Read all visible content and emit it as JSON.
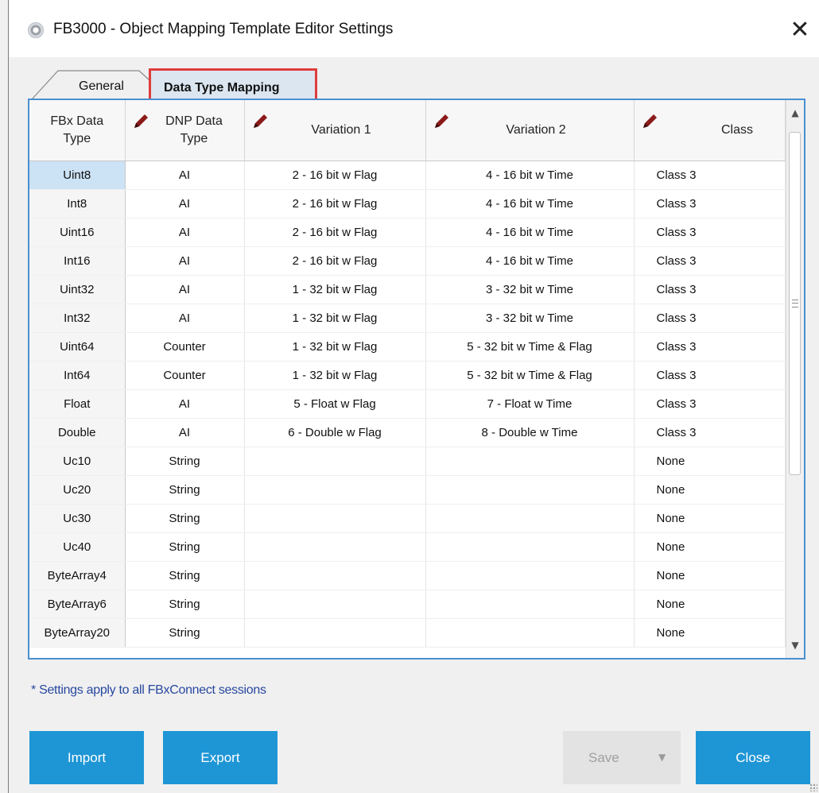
{
  "window": {
    "title": "FB3000 - Object Mapping Template Editor Settings",
    "close_glyph": "✕"
  },
  "tabs": [
    {
      "label": "General",
      "active": false
    },
    {
      "label": "Data Type Mapping",
      "active": true
    }
  ],
  "grid": {
    "columns": [
      {
        "label": "FBx Data\nType",
        "editable": false
      },
      {
        "label": "DNP Data\nType",
        "editable": true
      },
      {
        "label": "Variation 1",
        "editable": true
      },
      {
        "label": "Variation 2",
        "editable": true
      },
      {
        "label": "Class",
        "editable": true
      }
    ],
    "selected_row": 0,
    "rows": [
      [
        "Uint8",
        "AI",
        "2 - 16 bit w Flag",
        "4 - 16 bit w Time",
        "Class 3"
      ],
      [
        "Int8",
        "AI",
        "2 - 16 bit w Flag",
        "4 - 16 bit w Time",
        "Class 3"
      ],
      [
        "Uint16",
        "AI",
        "2 - 16 bit w Flag",
        "4 - 16 bit w Time",
        "Class 3"
      ],
      [
        "Int16",
        "AI",
        "2 - 16 bit w Flag",
        "4 - 16 bit w Time",
        "Class 3"
      ],
      [
        "Uint32",
        "AI",
        "1 - 32 bit w Flag",
        "3 - 32 bit w Time",
        "Class 3"
      ],
      [
        "Int32",
        "AI",
        "1 - 32 bit w Flag",
        "3 - 32 bit w Time",
        "Class 3"
      ],
      [
        "Uint64",
        "Counter",
        "1 - 32 bit w Flag",
        "5 - 32 bit w Time & Flag",
        "Class 3"
      ],
      [
        "Int64",
        "Counter",
        "1 - 32 bit w Flag",
        "5 - 32 bit w Time & Flag",
        "Class 3"
      ],
      [
        "Float",
        "AI",
        "5 - Float w Flag",
        "7 - Float w Time",
        "Class 3"
      ],
      [
        "Double",
        "AI",
        "6 - Double w Flag",
        "8 - Double w Time",
        "Class 3"
      ],
      [
        "Uc10",
        "String",
        "",
        "",
        "None"
      ],
      [
        "Uc20",
        "String",
        "",
        "",
        "None"
      ],
      [
        "Uc30",
        "String",
        "",
        "",
        "None"
      ],
      [
        "Uc40",
        "String",
        "",
        "",
        "None"
      ],
      [
        "ByteArray4",
        "String",
        "",
        "",
        "None"
      ],
      [
        "ByteArray6",
        "String",
        "",
        "",
        "None"
      ],
      [
        "ByteArray20",
        "String",
        "",
        "",
        "None"
      ]
    ]
  },
  "note": "* Settings apply to all FBxConnect sessions",
  "buttons": {
    "import": "Import",
    "export": "Export",
    "save": "Save",
    "close": "Close"
  },
  "colors": {
    "accent": "#1e96d6",
    "tab_highlight": "#e03c3c",
    "grid_border": "#4a8fd0",
    "pencil": "#8b1a1a"
  }
}
